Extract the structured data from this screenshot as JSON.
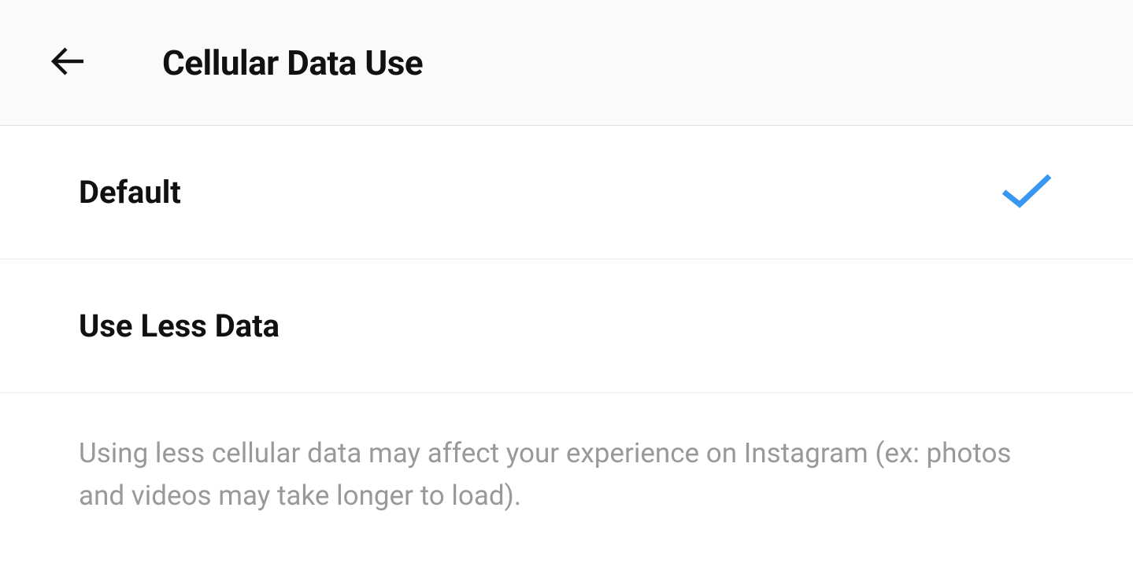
{
  "header": {
    "title": "Cellular Data Use"
  },
  "options": [
    {
      "label": "Default",
      "selected": true
    },
    {
      "label": "Use Less Data",
      "selected": false
    }
  ],
  "description": "Using less cellular data may affect your experience on Instagram (ex: photos and videos may take longer to load).",
  "colors": {
    "accent": "#3897f0"
  }
}
